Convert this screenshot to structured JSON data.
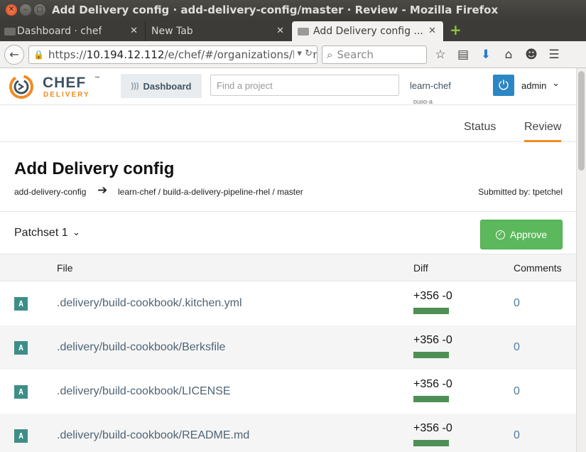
{
  "window": {
    "title": "Add Delivery config · add-delivery-config/master · Review - Mozilla Firefox"
  },
  "tabs": [
    {
      "label": "Dashboard · chef"
    },
    {
      "label": "New Tab"
    },
    {
      "label": "Add Delivery config ..."
    }
  ],
  "navbar": {
    "url_scheme": "https://",
    "url_host": "10.194.12.112",
    "url_path": "/e/chef/#/organizations/learn",
    "search_placeholder": "Search"
  },
  "app": {
    "logo_name": "CHEF",
    "logo_tm": "™",
    "logo_product": "DELIVERY",
    "dashboard_label": "Dashboard",
    "find_project_placeholder": "Find a project",
    "org_name": "learn-chef",
    "org_sub": "build-a",
    "user_name": "admin"
  },
  "view_tabs": {
    "status": "Status",
    "review": "Review"
  },
  "change": {
    "title": "Add Delivery config",
    "source_branch": "add-delivery-config",
    "target": "learn-chef / build-a-delivery-pipeline-rhel / master",
    "submitted_by": "Submitted by: tpetchel"
  },
  "patchset": {
    "label": "Patchset 1"
  },
  "approve_label": "Approve",
  "table": {
    "headers": {
      "file": "File",
      "diff": "Diff",
      "comments": "Comments"
    },
    "rows": [
      {
        "status": "A",
        "path": ".delivery/build-cookbook/.kitchen.yml",
        "diff": "+356 -0",
        "comments": "0"
      },
      {
        "status": "A",
        "path": ".delivery/build-cookbook/Berksfile",
        "diff": "+356 -0",
        "comments": "0"
      },
      {
        "status": "A",
        "path": ".delivery/build-cookbook/LICENSE",
        "diff": "+356 -0",
        "comments": "0"
      },
      {
        "status": "A",
        "path": ".delivery/build-cookbook/README.md",
        "diff": "+356 -0",
        "comments": "0"
      }
    ]
  },
  "colors": {
    "accent_orange": "#f18b21",
    "approve_green": "#5cb85c",
    "diff_bar_green": "#4e8f56",
    "badge_teal": "#3e8e87",
    "link_blue": "#4f7ca0"
  },
  "icons": {
    "back": "back-arrow-icon",
    "lock": "lock-icon",
    "dropdown": "chevron-down-icon",
    "reload": "reload-icon",
    "search": "search-icon",
    "bookmark": "star-icon",
    "reading_list": "reading-list-icon",
    "downloads": "download-icon",
    "home": "home-icon",
    "sync": "smiley-icon",
    "menu": "hamburger-menu-icon",
    "arrow": "right-arrow-icon",
    "approve": "check-circle-icon",
    "avatar": "power-icon"
  }
}
